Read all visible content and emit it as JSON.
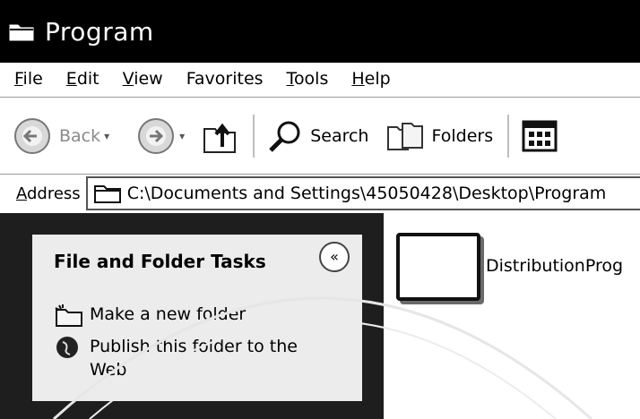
{
  "window": {
    "title": "Program"
  },
  "menu": [
    "File",
    "Edit",
    "View",
    "Favorites",
    "Tools",
    "Help"
  ],
  "toolbar": {
    "back_label": "Back",
    "search_label": "Search",
    "folders_label": "Folders"
  },
  "address": {
    "label": "Address",
    "path": "C:\\Documents and Settings\\45050428\\Desktop\\Program"
  },
  "tasks": {
    "title": "File and Folder Tasks",
    "collapse_glyph": "«",
    "items": [
      {
        "label": "Make a new folder",
        "icon": "new-folder-icon"
      },
      {
        "label": "Publish this folder to the Web",
        "icon": "publish-web-icon"
      }
    ]
  },
  "content": {
    "items": [
      {
        "name": "DistributionProg",
        "icon": "folder-icon"
      }
    ]
  }
}
